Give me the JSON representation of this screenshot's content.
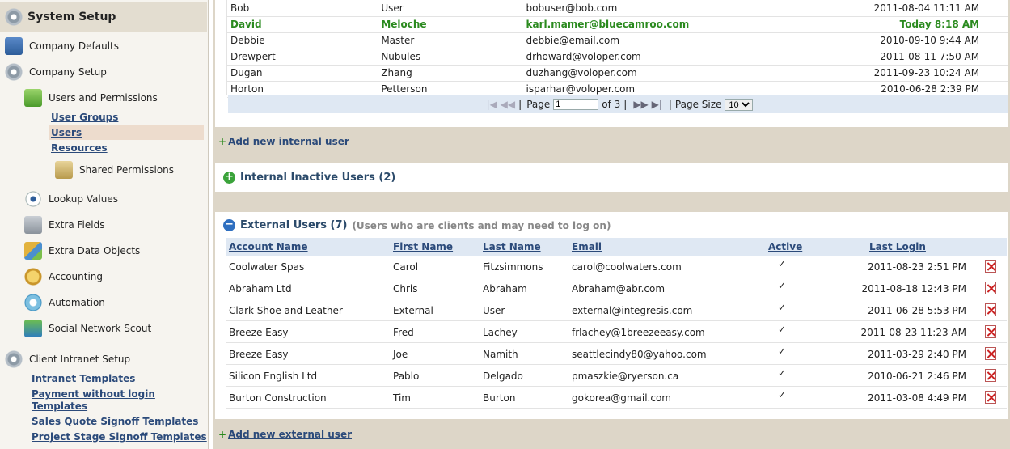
{
  "sidebar": {
    "title": "System Setup",
    "company_defaults": "Company Defaults",
    "company_setup": "Company Setup",
    "users_permissions": "Users and Permissions",
    "user_groups": "User Groups",
    "users": "Users",
    "resources": "Resources",
    "shared_permissions": "Shared Permissions",
    "lookup_values": "Lookup Values",
    "extra_fields": "Extra Fields",
    "extra_data_objects": "Extra Data Objects",
    "accounting": "Accounting",
    "automation": "Automation",
    "social_network_scout": "Social Network Scout",
    "client_intranet_setup": "Client Intranet Setup",
    "intranet_templates": "Intranet Templates",
    "payment_without_login_1": "Payment without login",
    "payment_without_login_2": "Templates",
    "sales_quote_signoff": "Sales Quote Signoff Templates",
    "project_stage_signoff": "Project Stage Signoff Templates"
  },
  "internal_users": {
    "rows": [
      {
        "first": "Bob",
        "last": "User",
        "email": "bobuser@bob.com",
        "last_login": "2011-08-04 11:11 AM"
      },
      {
        "first": "David",
        "last": "Meloche",
        "email": "karl.mamer@bluecamroo.com",
        "last_login": "Today 8:18 AM"
      },
      {
        "first": "Debbie",
        "last": "Master",
        "email": "debbie@email.com",
        "last_login": "2010-09-10 9:44 AM"
      },
      {
        "first": "Drewpert",
        "last": "Nubules",
        "email": "drhoward@voloper.com",
        "last_login": "2011-08-11 7:50 AM"
      },
      {
        "first": "Dugan",
        "last": "Zhang",
        "email": "duzhang@voloper.com",
        "last_login": "2011-09-23 10:24 AM"
      },
      {
        "first": "Horton",
        "last": "Petterson",
        "email": "isparhar@voloper.com",
        "last_login": "2010-06-28 2:39 PM"
      }
    ],
    "pager": {
      "page_label": "Page",
      "page_value": "1",
      "of_label": "of 3",
      "page_size_label": "Page Size",
      "page_size_value": "10"
    },
    "add_link": "Add new internal user"
  },
  "inactive": {
    "title": "Internal Inactive Users (2)"
  },
  "external": {
    "title": "External Users (7)",
    "subtitle": "(Users who are clients and may need to log on)",
    "headers": {
      "account": "Account Name",
      "first": "First Name",
      "last": "Last Name",
      "email": "Email",
      "active": "Active",
      "last_login": "Last Login"
    },
    "rows": [
      {
        "account": "Coolwater Spas",
        "first": "Carol",
        "last": "Fitzsimmons",
        "email": "carol@coolwaters.com",
        "last_login": "2011-08-23 2:51 PM"
      },
      {
        "account": "Abraham Ltd",
        "first": "Chris",
        "last": "Abraham",
        "email": "Abraham@abr.com",
        "last_login": "2011-08-18 12:43 PM"
      },
      {
        "account": "Clark Shoe and Leather",
        "first": "External",
        "last": "User",
        "email": "external@integresis.com",
        "last_login": "2011-06-28 5:53 PM"
      },
      {
        "account": "Breeze Easy",
        "first": "Fred",
        "last": "Lachey",
        "email": "frlachey@1breezeeasy.com",
        "last_login": "2011-08-23 11:23 AM"
      },
      {
        "account": "Breeze Easy",
        "first": "Joe",
        "last": "Namith",
        "email": "seattlecindy80@yahoo.com",
        "last_login": "2011-03-29 2:40 PM"
      },
      {
        "account": "Silicon English Ltd",
        "first": "Pablo",
        "last": "Delgado",
        "email": "pmaszkie@ryerson.ca",
        "last_login": "2010-06-21 2:46 PM"
      },
      {
        "account": "Burton Construction",
        "first": "Tim",
        "last": "Burton",
        "email": "gokorea@gmail.com",
        "last_login": "2011-03-08 4:49 PM"
      }
    ],
    "add_link": "Add new external user"
  },
  "colors": {
    "accent_blue": "#2b4a7a",
    "highlight_green": "#2a8a1e",
    "header_bg": "#dfe8f3",
    "sidebar_bg": "#f6f4ef"
  }
}
